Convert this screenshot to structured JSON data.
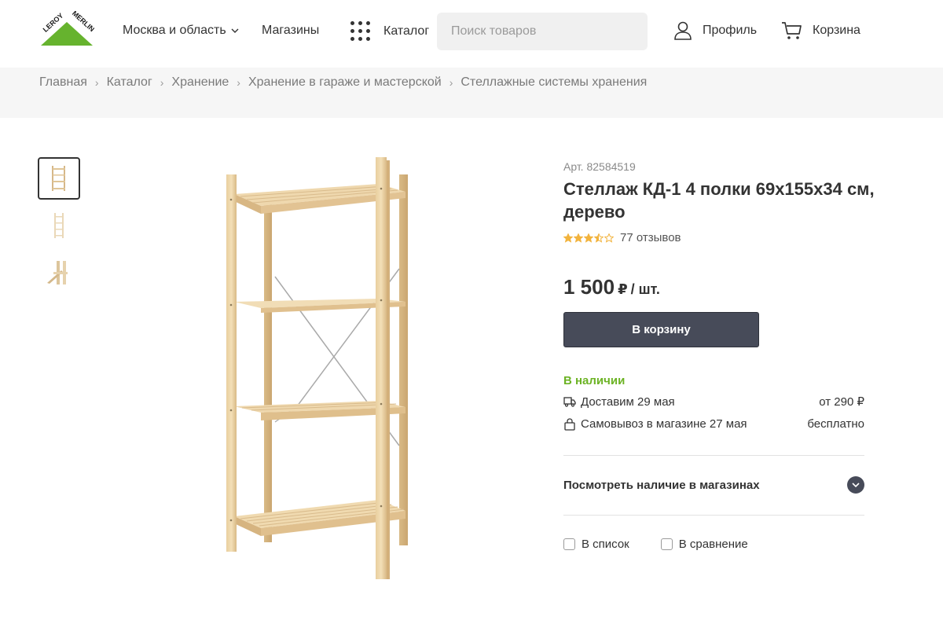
{
  "header": {
    "logo_text": "LEROY MERLIN",
    "region": "Москва и область",
    "stores": "Магазины",
    "catalog": "Каталог",
    "search_placeholder": "Поиск товаров",
    "profile": "Профиль",
    "cart": "Корзина"
  },
  "breadcrumbs": [
    "Главная",
    "Каталог",
    "Хранение",
    "Хранение в гараже и мастерской",
    "Стеллажные системы хранения"
  ],
  "gallery": {
    "thumbnails": [
      "front-view",
      "side-view",
      "detail-view"
    ],
    "active_index": 0
  },
  "product": {
    "article": "Арт. 82584519",
    "title": "Стеллаж КД-1 4 полки 69x155x34 см, дерево",
    "rating": 3.5,
    "rating_max": 5,
    "reviews": "77 отзывов",
    "price": "1 500",
    "currency": "₽",
    "unit": "/ шт.",
    "add_to_cart": "В корзину",
    "availability": "В наличии",
    "delivery_text": "Доставим 29 мая",
    "delivery_price": "от 290 ₽",
    "pickup_text": "Самовывоз в магазине 27 мая",
    "pickup_price": "бесплатно",
    "stock_check": "Посмотреть наличие в магазинах",
    "to_list": "В список",
    "to_compare": "В сравнение"
  },
  "colors": {
    "brand_green": "#66b32e",
    "button_dark": "#474b59",
    "in_stock_green": "#6cb324",
    "star": "#f2b33d"
  }
}
